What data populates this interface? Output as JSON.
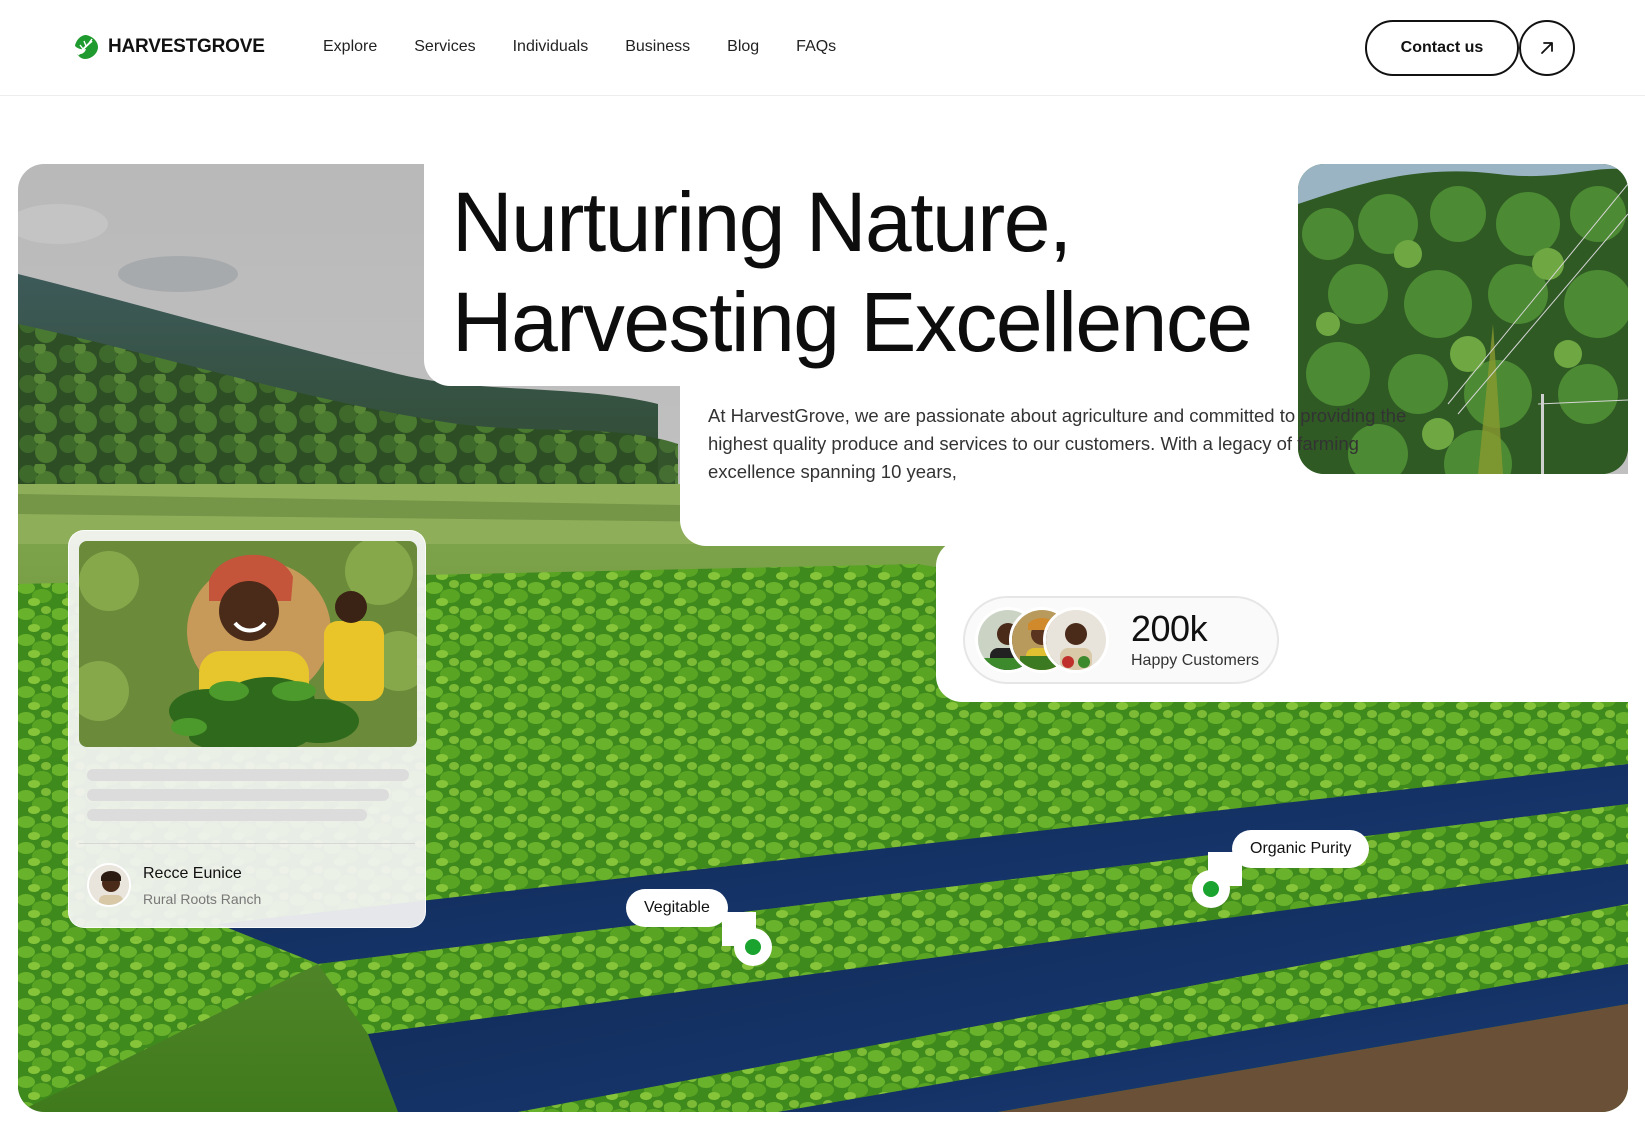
{
  "brand": {
    "name": "HARVESTGROVE",
    "logo_icon": "leaf-icon",
    "accent": "#1aa32e"
  },
  "nav": {
    "items": [
      "Explore",
      "Services",
      "Individuals",
      "Business",
      "Blog",
      "FAQs"
    ],
    "contact_label": "Contact us",
    "arrow_icon": "arrow-up-right-icon"
  },
  "hero": {
    "headline_line1": "Nurturing Nature,",
    "headline_line2": "Harvesting Excellence",
    "intro": "At HarvestGrove, we are passionate about agriculture and committed to providing the highest quality produce and services to our customers. With a legacy of farming excellence spanning 10 years,"
  },
  "stats": {
    "value": "200k",
    "label": "Happy Customers"
  },
  "profile_card": {
    "name": "Recce Eunice",
    "farm": "Rural Roots Ranch"
  },
  "tags": {
    "vegetable": "Vegitable",
    "organic": "Organic Purity"
  }
}
